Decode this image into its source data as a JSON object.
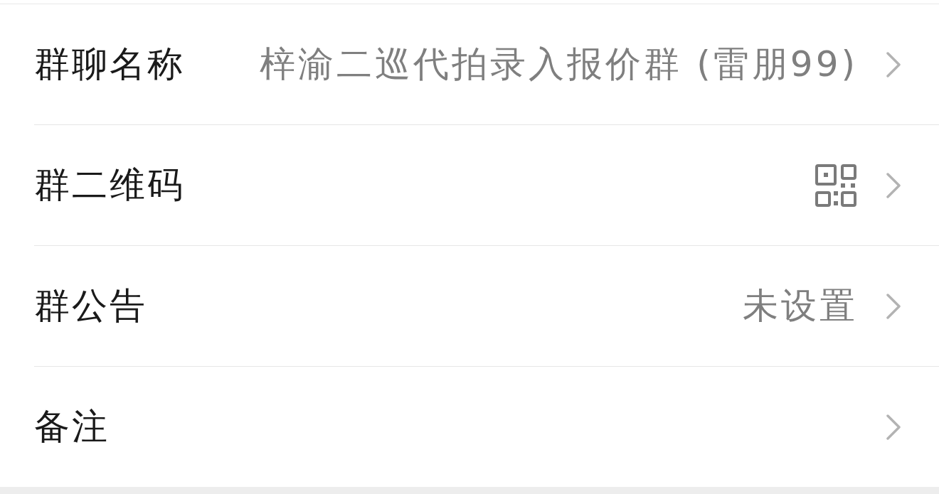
{
  "rows": [
    {
      "kind": "text",
      "label": "群聊名称",
      "value": "梓渝二巡代拍录入报价群 (雷朋99)"
    },
    {
      "kind": "qr",
      "label": "群二维码"
    },
    {
      "kind": "text",
      "label": "群公告",
      "value": "未设置"
    },
    {
      "kind": "plain",
      "label": "备注"
    }
  ]
}
